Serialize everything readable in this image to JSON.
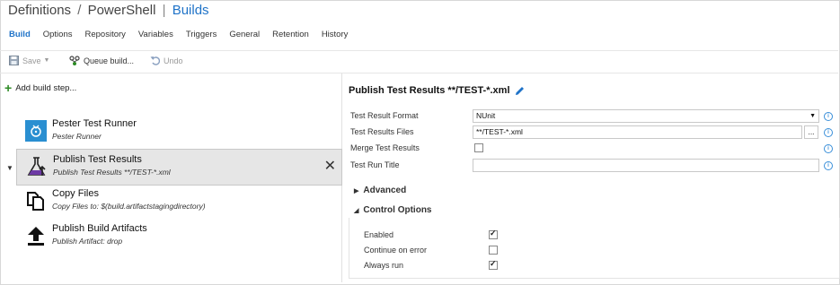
{
  "breadcrumb": {
    "part1": "Definitions",
    "sep": "/",
    "part2": "PowerShell",
    "pipe": "|",
    "current": "Builds"
  },
  "tabs": [
    {
      "label": "Build",
      "active": true
    },
    {
      "label": "Options"
    },
    {
      "label": "Repository"
    },
    {
      "label": "Variables"
    },
    {
      "label": "Triggers"
    },
    {
      "label": "General"
    },
    {
      "label": "Retention"
    },
    {
      "label": "History"
    }
  ],
  "toolbar": {
    "save": "Save",
    "queue": "Queue build...",
    "undo": "Undo"
  },
  "left": {
    "add_step": "Add build step...",
    "steps": [
      {
        "title": "Pester Test Runner",
        "sub": "Pester Runner",
        "icon": "pester-icon"
      },
      {
        "title": "Publish Test Results",
        "sub": "Publish Test Results **/TEST-*.xml",
        "icon": "flask-icon",
        "selected": true
      },
      {
        "title": "Copy Files",
        "sub": "Copy Files to: $(build.artifactstagingdirectory)",
        "icon": "copy-icon"
      },
      {
        "title": "Publish Build Artifacts",
        "sub": "Publish Artifact: drop",
        "icon": "upload-icon"
      }
    ]
  },
  "right": {
    "title": "Publish Test Results **/TEST-*.xml",
    "fields": {
      "format_label": "Test Result Format",
      "format_value": "NUnit",
      "files_label": "Test Results Files",
      "files_value": "**/TEST-*.xml",
      "browse": "...",
      "merge_label": "Merge Test Results",
      "merge_checked": false,
      "title_label": "Test Run Title",
      "title_value": ""
    },
    "advanced": "Advanced",
    "control_options": "Control Options",
    "options": [
      {
        "label": "Enabled",
        "checked": true
      },
      {
        "label": "Continue on error",
        "checked": false
      },
      {
        "label": "Always run",
        "checked": true
      }
    ]
  },
  "colors": {
    "accent": "#1f73c8",
    "add_green": "#2c8a24",
    "info_blue": "#3a8fd9"
  }
}
